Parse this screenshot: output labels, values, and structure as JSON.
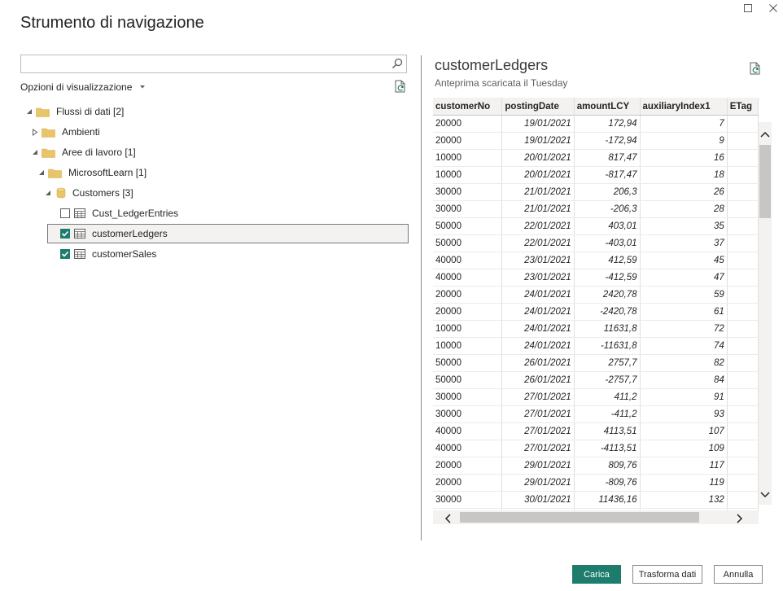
{
  "dialog": {
    "title": "Strumento di navigazione"
  },
  "search": {
    "value": "",
    "placeholder": ""
  },
  "view_options": {
    "label": "Opzioni di visualizzazione"
  },
  "tree": [
    {
      "label": "Flussi di dati [2]",
      "icon": "folder-icon",
      "expander": "expanded"
    },
    {
      "label": "Ambienti",
      "icon": "folder-icon",
      "expander": "collapsed"
    },
    {
      "label": "Aree di lavoro [1]",
      "icon": "folder-icon",
      "expander": "expanded"
    },
    {
      "label": "MicrosoftLearn [1]",
      "icon": "folder-icon",
      "expander": "expanded"
    },
    {
      "label": "Customers [3]",
      "icon": "database-icon",
      "expander": "expanded"
    },
    {
      "label": "Cust_LedgerEntries",
      "icon": "table-icon",
      "checked": false
    },
    {
      "label": "customerLedgers",
      "icon": "table-icon",
      "checked": true,
      "selected": true
    },
    {
      "label": "customerSales",
      "icon": "table-icon",
      "checked": true
    }
  ],
  "preview": {
    "title": "customerLedgers",
    "subtitle": "Anteprima scaricata il Tuesday",
    "columns": [
      "customerNo",
      "postingDate",
      "amountLCY",
      "auxiliaryIndex1",
      "ETag"
    ],
    "rows": [
      [
        "20000",
        "19/01/2021",
        "172,94",
        "7",
        ""
      ],
      [
        "20000",
        "19/01/2021",
        "-172,94",
        "9",
        ""
      ],
      [
        "10000",
        "20/01/2021",
        "817,47",
        "16",
        ""
      ],
      [
        "10000",
        "20/01/2021",
        "-817,47",
        "18",
        ""
      ],
      [
        "30000",
        "21/01/2021",
        "206,3",
        "26",
        ""
      ],
      [
        "30000",
        "21/01/2021",
        "-206,3",
        "28",
        ""
      ],
      [
        "50000",
        "22/01/2021",
        "403,01",
        "35",
        ""
      ],
      [
        "50000",
        "22/01/2021",
        "-403,01",
        "37",
        ""
      ],
      [
        "40000",
        "23/01/2021",
        "412,59",
        "45",
        ""
      ],
      [
        "40000",
        "23/01/2021",
        "-412,59",
        "47",
        ""
      ],
      [
        "20000",
        "24/01/2021",
        "2420,78",
        "59",
        ""
      ],
      [
        "20000",
        "24/01/2021",
        "-2420,78",
        "61",
        ""
      ],
      [
        "10000",
        "24/01/2021",
        "11631,8",
        "72",
        ""
      ],
      [
        "10000",
        "24/01/2021",
        "-11631,8",
        "74",
        ""
      ],
      [
        "50000",
        "26/01/2021",
        "2757,7",
        "82",
        ""
      ],
      [
        "50000",
        "26/01/2021",
        "-2757,7",
        "84",
        ""
      ],
      [
        "30000",
        "27/01/2021",
        "411,2",
        "91",
        ""
      ],
      [
        "30000",
        "27/01/2021",
        "-411,2",
        "93",
        ""
      ],
      [
        "40000",
        "27/01/2021",
        "4113,51",
        "107",
        ""
      ],
      [
        "40000",
        "27/01/2021",
        "-4113,51",
        "109",
        ""
      ],
      [
        "20000",
        "29/01/2021",
        "809,76",
        "117",
        ""
      ],
      [
        "20000",
        "29/01/2021",
        "-809,76",
        "119",
        ""
      ],
      [
        "30000",
        "30/01/2021",
        "11436,16",
        "132",
        ""
      ],
      [
        "",
        "",
        "",
        "",
        ""
      ]
    ]
  },
  "buttons": {
    "load": "Carica",
    "transform": "Trasforma dati",
    "cancel": "Annulla"
  },
  "colors": {
    "accent": "#1e7c6c",
    "folder": "#e8c46a"
  }
}
